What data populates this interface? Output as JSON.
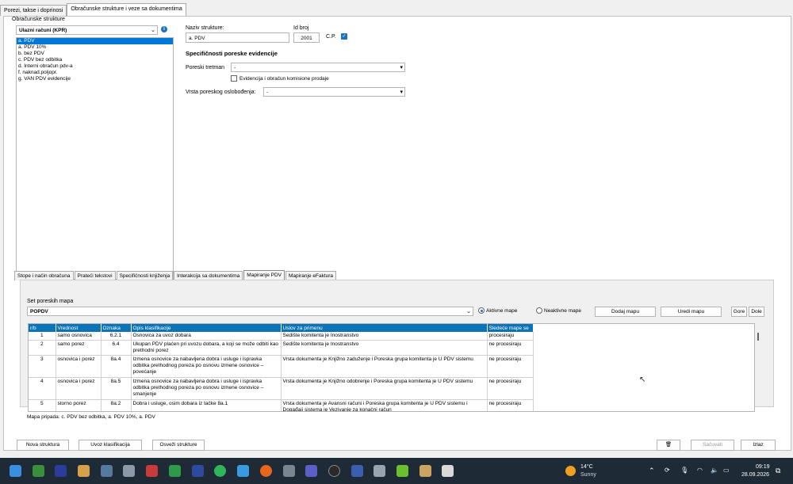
{
  "top_tabs": [
    "Porezi, takse i doprinosi",
    "Obračunske strukture i veze sa dokumentima"
  ],
  "left": {
    "group_title": "Obračunske strukture",
    "selector_value": "Ulazni računi (KPR)",
    "items": [
      "a. PDV",
      "a. PDV 10%",
      "b. bez PDV",
      "c. PDV bez odbitka",
      "d. Interni obračun pdv-a",
      "f. naknad.poljopr.",
      "g. VAN PDV evidencije"
    ]
  },
  "form": {
    "naziv_label": "Naziv strukture:",
    "naziv_value": "a. PDV",
    "id_label": "Id broj",
    "id_value": "2001",
    "cp_label": "C.P.",
    "section_title": "Specifičnosti poreske evidencije",
    "poreski_label": "Poreski tretman",
    "poreski_value": "-",
    "evidencija_label": "Evidencija i obračun komisione prodaje",
    "vrsta_label": "Vrsta poreskog oslobođenja:",
    "vrsta_value": "-"
  },
  "bottom_tabs": [
    "Stope i način obračuna",
    "Prateći tekstovi",
    "Specifičnosti knjiženja",
    "Interakcija sa dokumentima",
    "Mapiranje PDV",
    "Mapiranje eFaktura"
  ],
  "mapping": {
    "set_label": "Set poreskih mapa",
    "set_value": "POPDV",
    "radio_active": "Aktivne mape",
    "radio_inactive": "Neaktivne mape",
    "add_button": "Dodaj mapu",
    "edit_button": "Uredi mapu",
    "up_button": "Gore",
    "down_button": "Dole",
    "columns": [
      "r/b",
      "Vrednost",
      "Oznaka",
      "Opis klasifikacije",
      "Uslov za primenu",
      "Sledeće mape se"
    ],
    "rows": [
      {
        "rb": "1",
        "vrednost": "samo osnovica",
        "oznaka": "6.2.1",
        "opis": "Osnovica za uvoz dobara",
        "uslov": "Sedište komitenta je Inostranstvo",
        "sledece": "procesiraju"
      },
      {
        "rb": "2",
        "vrednost": "samo porez",
        "oznaka": "6.4",
        "opis": "Ukupan PDV plaćen pri uvozu dobara, a koji se može odbiti kao prethodni porez",
        "uslov": "Sedište komitenta je Inostranstvo",
        "sledece": "ne procesiraju"
      },
      {
        "rb": "3",
        "vrednost": "osnovica i porez",
        "oznaka": "8a.4",
        "opis": "Izmena osnovice za nabavljena dobra i usluge i ispravka odbitka prethodnog poreza po osnovu izmene osnovice – povećanje",
        "uslov": "Vrsta dokumenta je Knjižno zaduženje i Poreska grupa komitenta je U PDV sistemu",
        "sledece": "ne procesiraju"
      },
      {
        "rb": "4",
        "vrednost": "osnovica i porez",
        "oznaka": "8a.5",
        "opis": "Izmena osnovice za nabavljena dobra i usluge i ispravka odbitka prethodnog poreza po osnovu izmene osnovice – smanjenje",
        "uslov": "Vrsta dokumenta je Knjižno odobrenje i Poreska grupa komitenta je U PDV sistemu",
        "sledece": "ne procesiraju"
      },
      {
        "rb": "5",
        "vrednost": "storno porez",
        "oznaka": "8a.2",
        "opis": "Dobra i usluge, osim dobara iz tačke 8a.1",
        "uslov": "Vrsta dokumenta je Avansni računi i Poreska grupa komitenta je U PDV sistemu i Događaji sistema je Vezivanje za konačni račun",
        "sledece": "ne procesiraju"
      }
    ],
    "footer_text": "Mapa pripada: c. PDV bez odbitka, a. PDV 10%, a. PDV"
  },
  "footer": {
    "new_button": "Nova struktura",
    "import_button": "Uvoz klasifikacija",
    "refresh_button": "Osveži strukture",
    "save_button": "Sačuvati",
    "exit_button": "Izlaz"
  },
  "taskbar": {
    "temperature": "14°C",
    "weather": "Sunny",
    "time": "09:19",
    "date": "28.09.2026"
  }
}
